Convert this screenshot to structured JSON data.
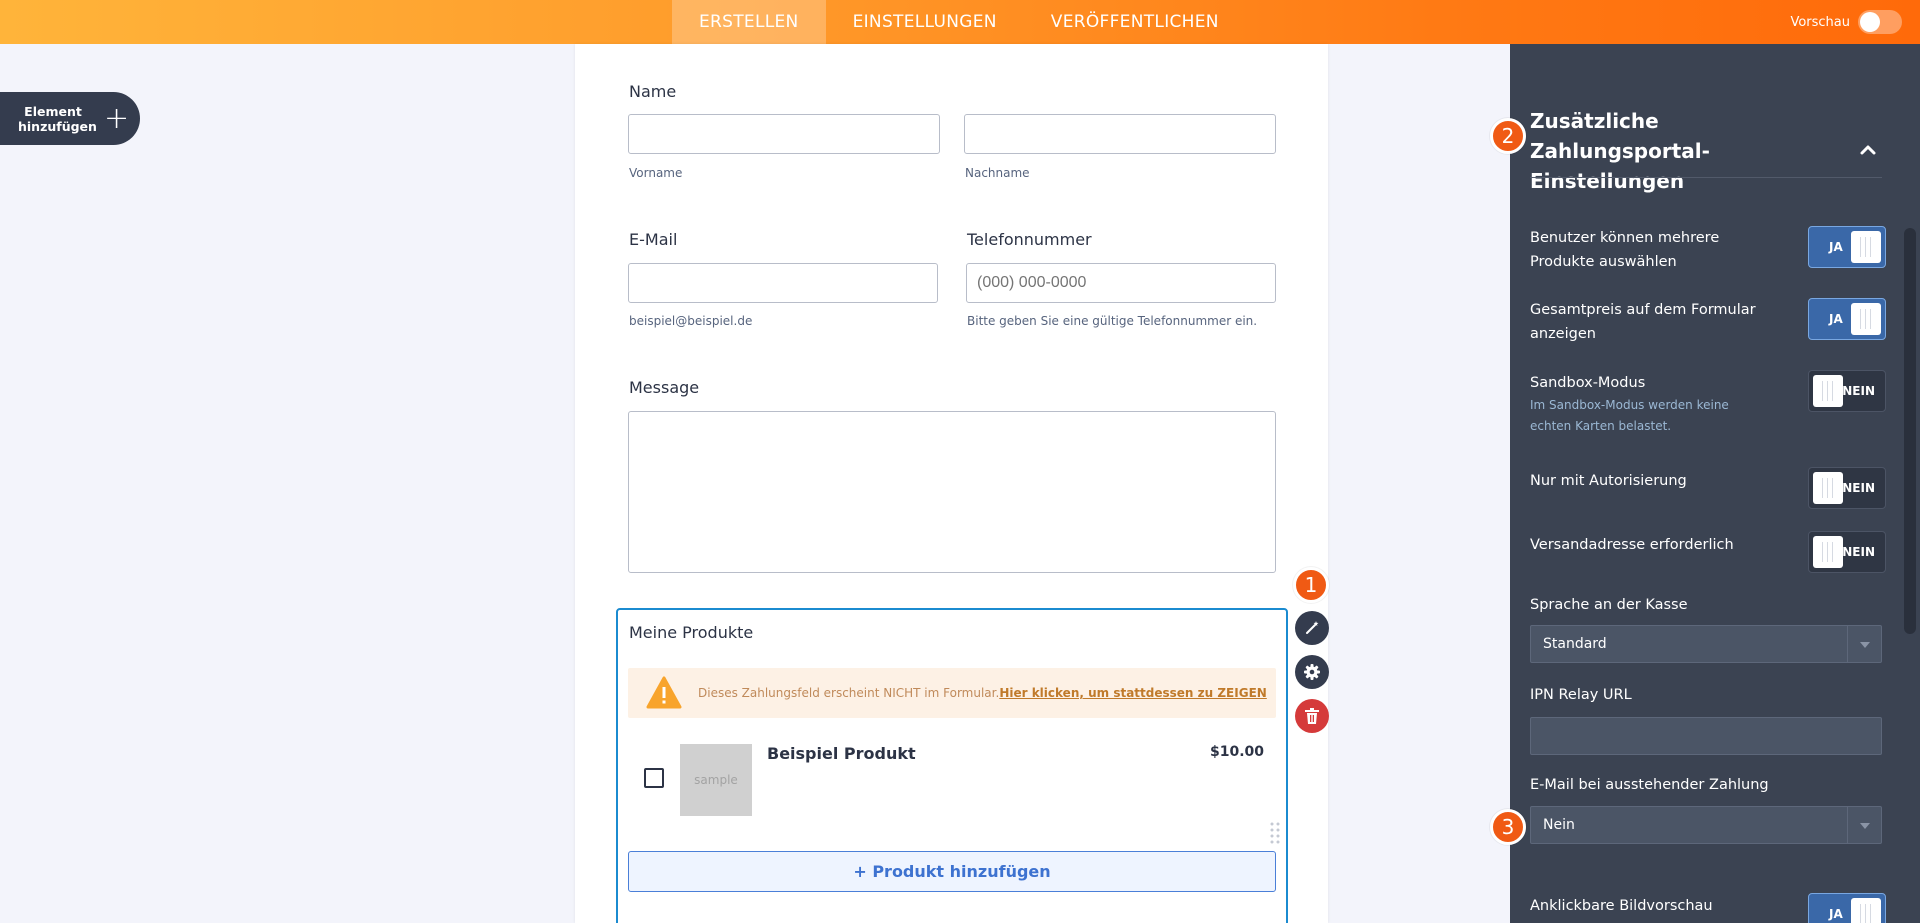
{
  "topbar": {
    "tabs": [
      {
        "label": "ERSTELLEN",
        "active": true
      },
      {
        "label": "EINSTELLUNGEN",
        "active": false
      },
      {
        "label": "VERÖFFENTLICHEN",
        "active": false
      }
    ],
    "preview_label": "Vorschau"
  },
  "add_element": {
    "line1": "Element",
    "line2": "hinzufügen"
  },
  "form": {
    "name": {
      "label": "Name",
      "first_sub": "Vorname",
      "last_sub": "Nachname"
    },
    "email": {
      "label": "E-Mail",
      "sub": "beispiel@beispiel.de"
    },
    "phone": {
      "label": "Telefonnummer",
      "placeholder": "(000) 000-0000",
      "sub": "Bitte geben Sie eine gültige Telefonnummer ein."
    },
    "message": {
      "label": "Message"
    },
    "products": {
      "label": "Meine Produkte",
      "warning_text": "Dieses Zahlungsfeld erscheint NICHT im Formular.",
      "warning_link": "Hier klicken, um stattdessen zu ZEIGEN",
      "items": [
        {
          "name": "Beispiel Produkt",
          "price": "$10.00",
          "thumb_text": "sample"
        }
      ],
      "add_button": "+ Produkt hinzufügen"
    }
  },
  "badges": [
    "1",
    "2",
    "3"
  ],
  "panel": {
    "title": "Zusätzliche Zahlungsportal-Einstellungen",
    "settings": [
      {
        "label": "Benutzer können mehrere Produkte auswählen",
        "state": "JA"
      },
      {
        "label": "Gesamtpreis auf dem Formular anzeigen",
        "state": "JA"
      },
      {
        "label": "Sandbox-Modus",
        "desc": "Im Sandbox-Modus werden keine echten Karten belastet.",
        "state": "NEIN"
      },
      {
        "label": "Nur mit Autorisierung",
        "state": "NEIN"
      },
      {
        "label": "Versandadresse erforderlich",
        "state": "NEIN"
      }
    ],
    "language": {
      "label": "Sprache an der Kasse",
      "value": "Standard"
    },
    "ipn": {
      "label": "IPN Relay URL",
      "value": ""
    },
    "pending_email": {
      "label": "E-Mail bei ausstehender Zahlung",
      "value": "Nein"
    },
    "image_preview": {
      "label": "Anklickbare Bildvorschau",
      "state": "JA"
    }
  }
}
